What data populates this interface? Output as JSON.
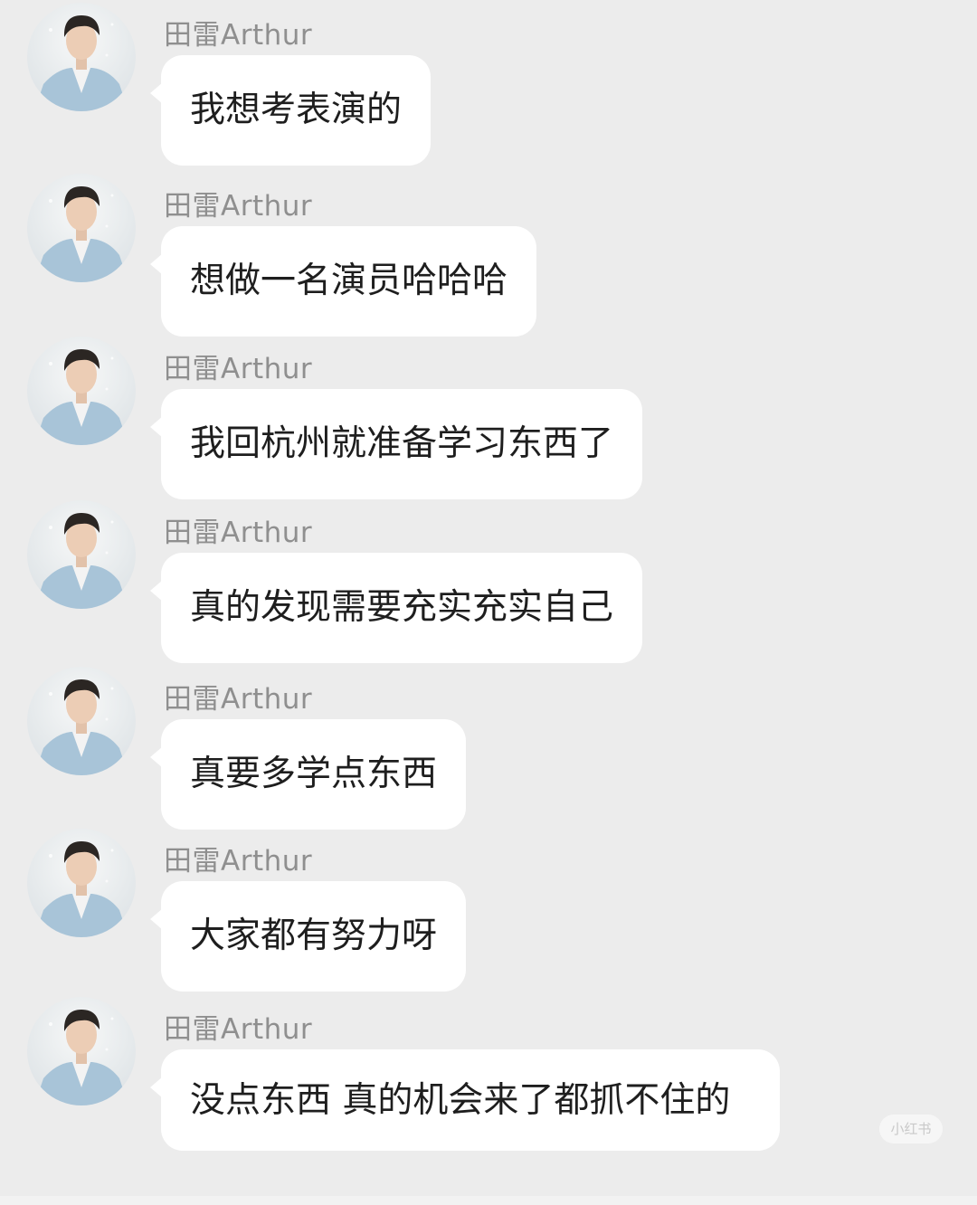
{
  "sender_name": "田雷Arthur",
  "messages": [
    {
      "text": "我想考表演的"
    },
    {
      "text": "想做一名演员哈哈哈"
    },
    {
      "text": "我回杭州就准备学习东西了"
    },
    {
      "text": "真的发现需要充实充实自己"
    },
    {
      "text": "真要多学点东西"
    },
    {
      "text": "大家都有努力呀"
    },
    {
      "text": "没点东西 真的机会来了都抓不住的"
    }
  ],
  "watermark": "小红书",
  "colors": {
    "background": "#ececec",
    "bubble": "#ffffff",
    "sender": "#8f8f8f",
    "text": "#1e1e1e",
    "jacket": "#a8c4d8"
  }
}
